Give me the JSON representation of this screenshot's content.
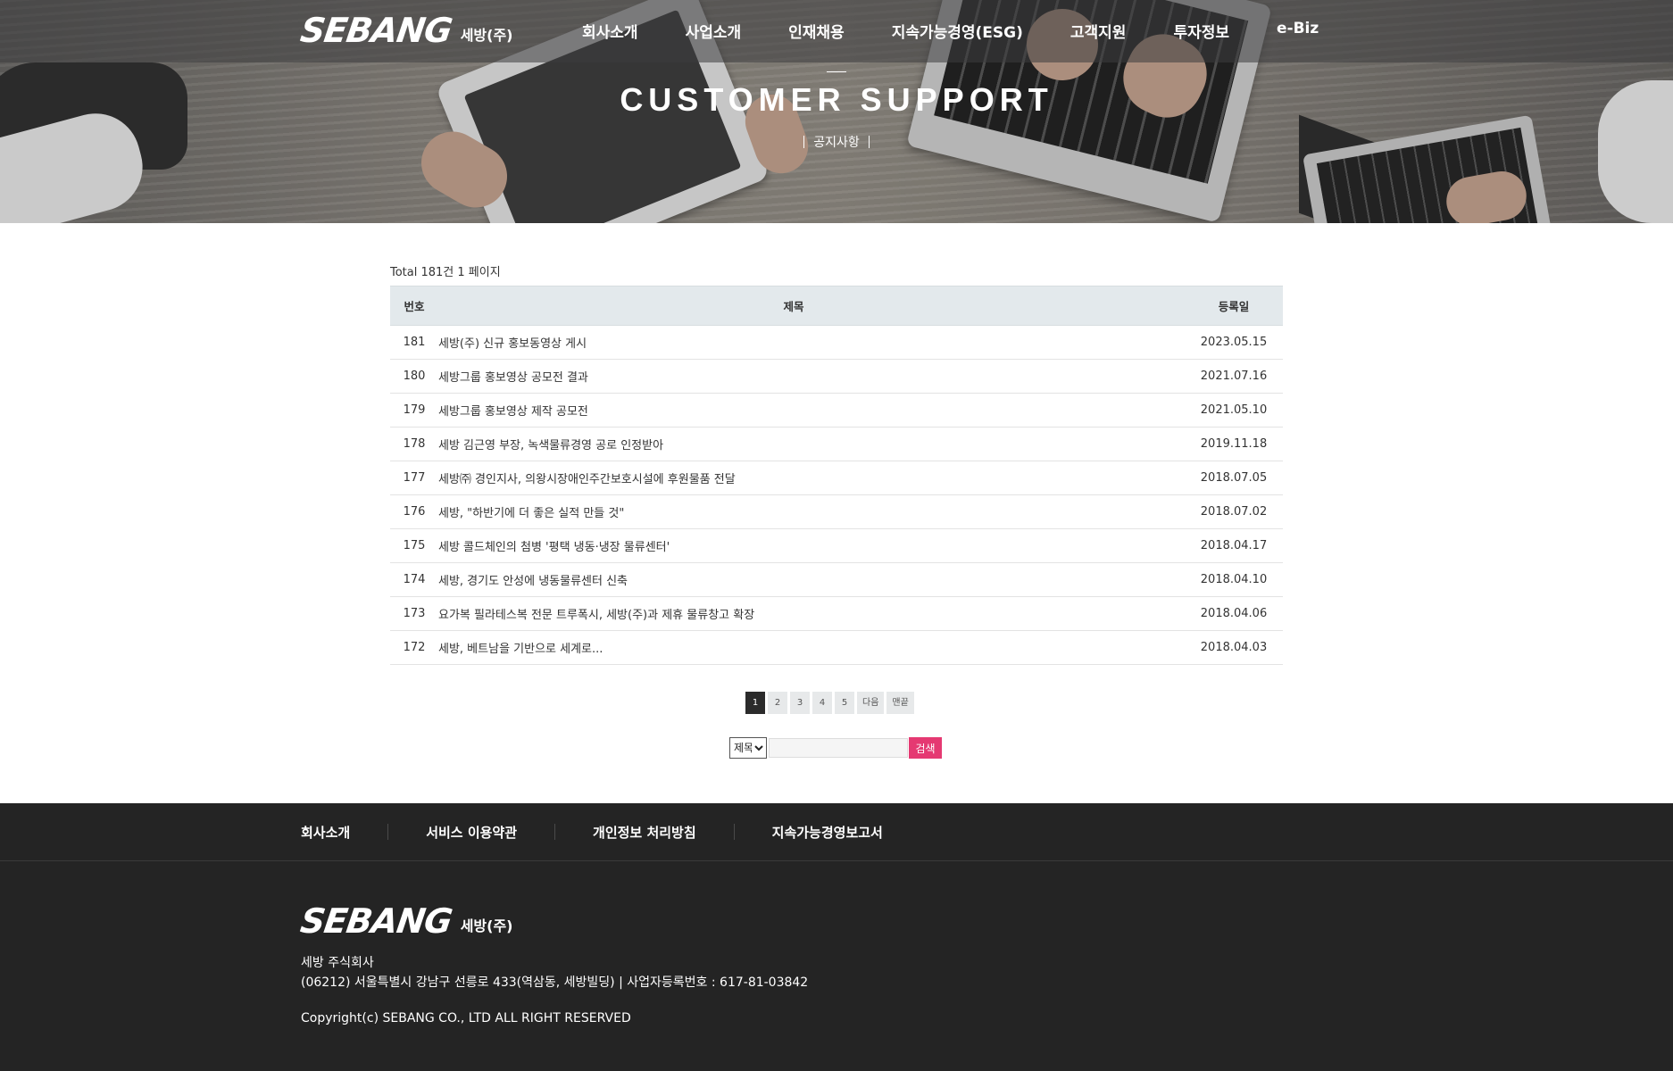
{
  "brand": {
    "logo_text": "SEBANG",
    "korean_name": "세방(주)"
  },
  "nav": [
    "회사소개",
    "사업소개",
    "인재채용",
    "지속가능경영(ESG)",
    "고객지원",
    "투자정보",
    "e-Biz"
  ],
  "hero": {
    "title": "CUSTOMER SUPPORT",
    "subtitle": "공지사항"
  },
  "board": {
    "total_text": "Total 181건 1 페이지",
    "headers": {
      "num": "번호",
      "title": "제목",
      "date": "등록일"
    },
    "rows": [
      {
        "num": "181",
        "title": "세방(주) 신규 홍보동영상 게시",
        "date": "2023.05.15"
      },
      {
        "num": "180",
        "title": "세방그룹 홍보영상 공모전 결과",
        "date": "2021.07.16"
      },
      {
        "num": "179",
        "title": "세방그룹 홍보영상 제작 공모전",
        "date": "2021.05.10"
      },
      {
        "num": "178",
        "title": "세방 김근영 부장, 녹색물류경영 공로 인정받아",
        "date": "2019.11.18"
      },
      {
        "num": "177",
        "title": "세방㈜ 경인지사, 의왕시장애인주간보호시설에 후원물품 전달",
        "date": "2018.07.05"
      },
      {
        "num": "176",
        "title": "세방, \"하반기에 더 좋은 실적 만들 것\"",
        "date": "2018.07.02"
      },
      {
        "num": "175",
        "title": "세방 콜드체인의 첨병 '평택 냉동·냉장 물류센터'",
        "date": "2018.04.17"
      },
      {
        "num": "174",
        "title": "세방, 경기도 안성에 냉동물류센터 신축",
        "date": "2018.04.10"
      },
      {
        "num": "173",
        "title": "요가복 필라테스복 전문 트루폭시, 세방(주)과 제휴 물류창고 확장",
        "date": "2018.04.06"
      },
      {
        "num": "172",
        "title": "세방, 베트남을 기반으로 세계로...",
        "date": "2018.04.03"
      }
    ]
  },
  "paging": {
    "current": "1",
    "pages": [
      "2",
      "3",
      "4",
      "5"
    ],
    "next": "다음",
    "last": "맨끝"
  },
  "search": {
    "selected_option": "제목",
    "input_value": "",
    "button_label": "검색"
  },
  "footer": {
    "links": [
      "회사소개",
      "서비스 이용약관",
      "개인정보 처리방침",
      "지속가능경영보고서"
    ],
    "company": "세방 주식회사",
    "address": "(06212) 서울특별시 강남구 선릉로 433(역삼동, 세방빌딩) | 사업자등록번호 : 617-81-03842",
    "copyright": "Copyright(c) SEBANG CO., LTD ALL RIGHT RESERVED"
  },
  "colors": {
    "search_button": "#e53972",
    "footer_bg": "#242424",
    "table_header_bg": "#e3e9ec",
    "active_page": "#2b2b2b"
  }
}
